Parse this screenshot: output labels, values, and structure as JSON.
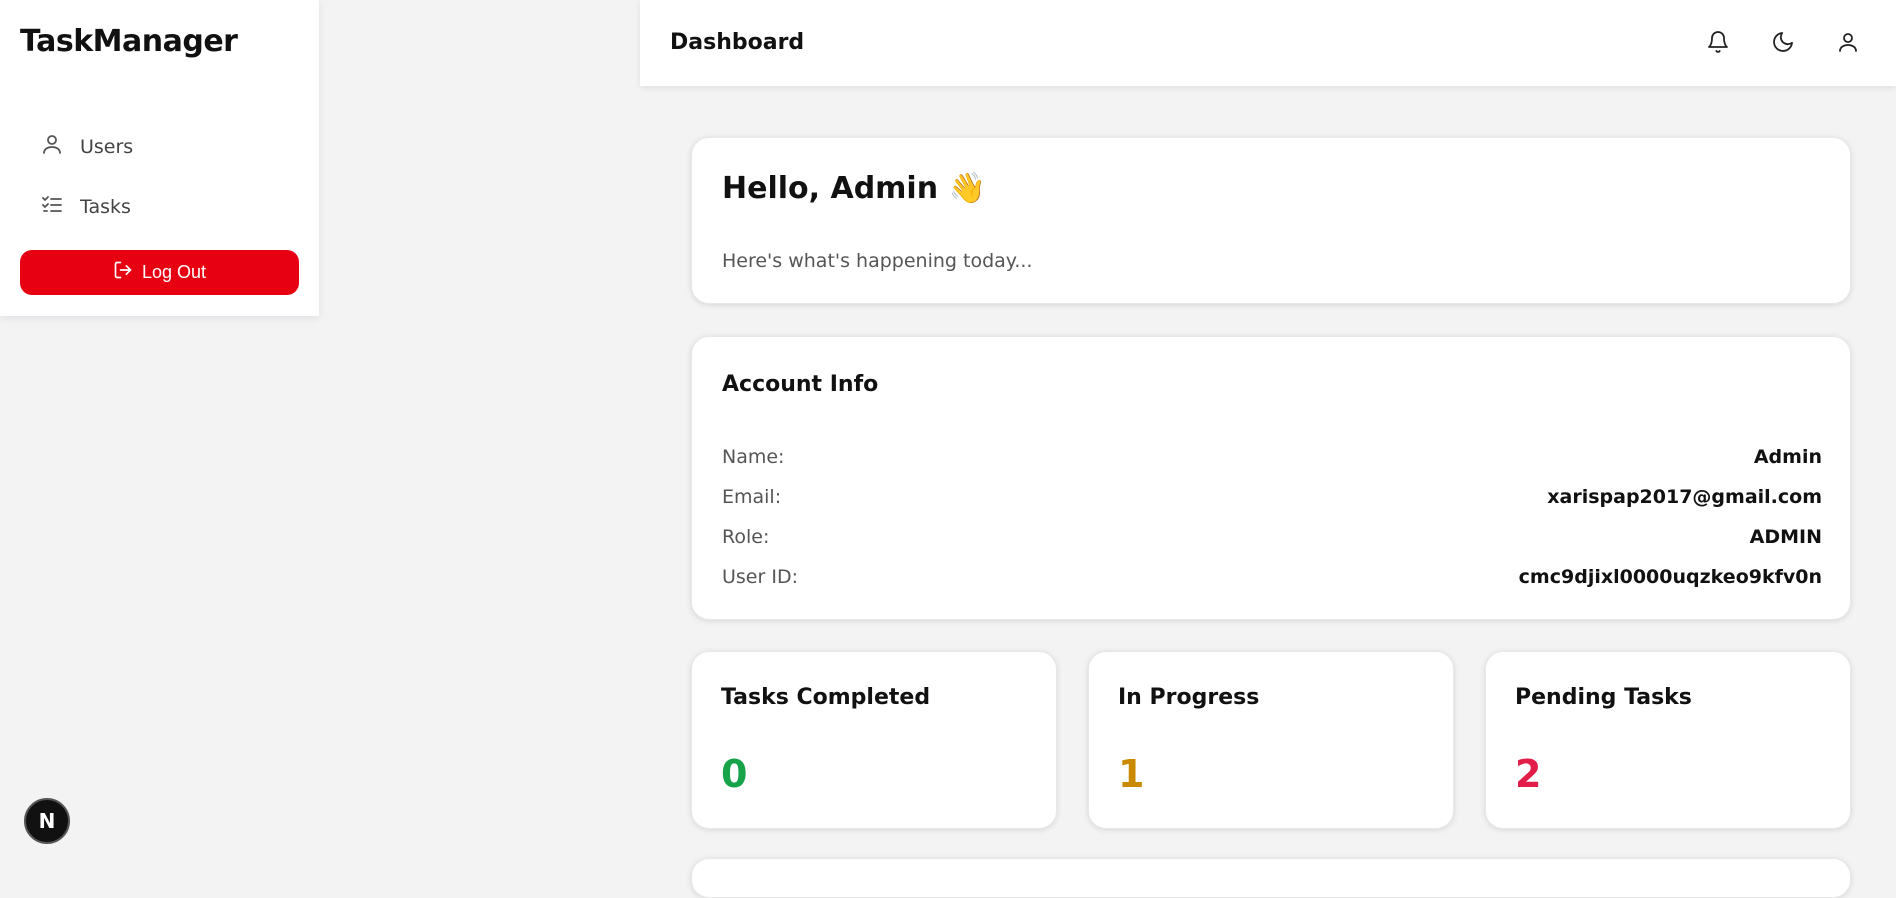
{
  "sidebar": {
    "brand": "TaskManager",
    "items": [
      {
        "label": "Users",
        "icon": "user-icon"
      },
      {
        "label": "Tasks",
        "icon": "task-list-icon"
      }
    ],
    "logout_label": "Log Out"
  },
  "header": {
    "title": "Dashboard",
    "icons": [
      "bell-icon",
      "moon-icon",
      "user-icon"
    ]
  },
  "hello": {
    "title": "Hello, Admin 👋",
    "subtitle": "Here's what's happening today..."
  },
  "account": {
    "title": "Account Info",
    "rows": [
      {
        "label": "Name:",
        "value": "Admin"
      },
      {
        "label": "Email:",
        "value": "xarispap2017@gmail.com"
      },
      {
        "label": "Role:",
        "value": "ADMIN"
      },
      {
        "label": "User ID:",
        "value": "cmc9djixl0000uqzkeo9kfv0n"
      }
    ]
  },
  "stats": [
    {
      "title": "Tasks Completed",
      "value": "0",
      "color": "#16a34a"
    },
    {
      "title": "In Progress",
      "value": "1",
      "color": "#ca8a04"
    },
    {
      "title": "Pending Tasks",
      "value": "2",
      "color": "#e11d48"
    }
  ],
  "colors": {
    "accent": "#e60012",
    "background": "#f3f3f4"
  },
  "badge": {
    "label": "N"
  }
}
